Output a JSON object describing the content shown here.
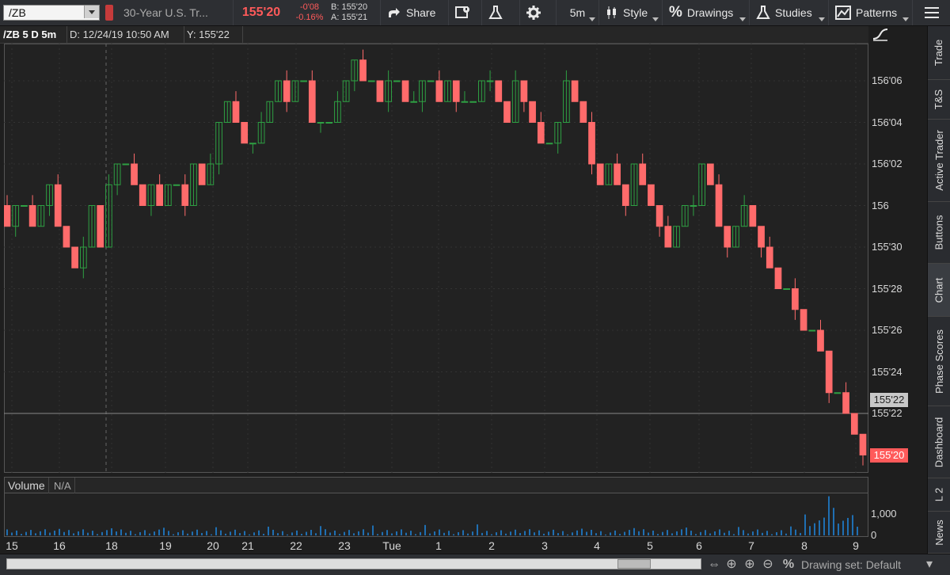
{
  "toolbar": {
    "symbol": "/ZB",
    "description": "30-Year U.S. Tr...",
    "last_price": "155'20",
    "net_change": "-0'08",
    "pct_change": "-0.16%",
    "bid": "B: 155'20",
    "ask": "A: 155'21",
    "share_label": "Share",
    "timeframe_label": "5m",
    "style_label": "Style",
    "drawings_label": "Drawings",
    "studies_label": "Studies",
    "patterns_label": "Patterns"
  },
  "chart_header": {
    "symbol_period": "/ZB 5 D 5m",
    "date_readout": "D: 12/24/19 10:50 AM",
    "y_readout": "Y: 155'22"
  },
  "price_axis": {
    "ticks": [
      "156'06",
      "156'04",
      "156'02",
      "156",
      "155'30",
      "155'28",
      "155'26",
      "155'24",
      "155'22"
    ],
    "cursor_price": "155'22",
    "current_price": "155'20"
  },
  "volume": {
    "title": "Volume",
    "value": "N/A",
    "tick_high": "1,000",
    "tick_low": "0"
  },
  "x_axis": {
    "labels": [
      "15",
      "16",
      "18",
      "19",
      "20",
      "21",
      "22",
      "23",
      "Tue",
      "1",
      "2",
      "3",
      "4",
      "5",
      "6",
      "7",
      "8",
      "9"
    ]
  },
  "sidebar": {
    "tabs": [
      "Trade",
      "T&S",
      "Active Trader",
      "Buttons",
      "Chart",
      "Phase Scores",
      "Dashboard",
      "L 2",
      "News"
    ]
  },
  "bottom_bar": {
    "drawing_set": "Drawing set: Default"
  },
  "colors": {
    "up": "#2ea043",
    "down": "#ff6b6b",
    "accent_price": "#ff5a5a",
    "volume": "#1f6fb2"
  },
  "chart_data": {
    "type": "candlestick",
    "y_unit": "32nds of a point",
    "ylim": [
      155.59375,
      156.21875
    ],
    "price_at_tick": [
      156.1875,
      156.125,
      156.0625,
      156.0,
      155.9375,
      155.875,
      155.8125,
      155.75,
      155.6875
    ],
    "close_series": [
      155.96875,
      156.0,
      156.0,
      155.96875,
      156.0,
      156.03125,
      155.96875,
      155.9375,
      155.90625,
      155.9375,
      156.0,
      155.9375,
      156.03125,
      156.0625,
      156.0625,
      156.03125,
      156.0,
      156.03125,
      156.0,
      156.03125,
      156.03125,
      156.0,
      156.0625,
      156.03125,
      156.0625,
      156.125,
      156.15625,
      156.125,
      156.09375,
      156.09375,
      156.125,
      156.15625,
      156.1875,
      156.15625,
      156.1875,
      156.1875,
      156.125,
      156.125,
      156.125,
      156.15625,
      156.1875,
      156.21875,
      156.1875,
      156.1875,
      156.15625,
      156.1875,
      156.1875,
      156.15625,
      156.15625,
      156.1875,
      156.1875,
      156.15625,
      156.1875,
      156.15625,
      156.15625,
      156.15625,
      156.1875,
      156.1875,
      156.15625,
      156.125,
      156.1875,
      156.15625,
      156.125,
      156.09375,
      156.09375,
      156.125,
      156.1875,
      156.15625,
      156.125,
      156.0625,
      156.03125,
      156.0625,
      156.03125,
      156.0,
      156.0625,
      156.03125,
      156.0,
      155.96875,
      155.9375,
      155.96875,
      156.0,
      156.0,
      156.0625,
      156.03125,
      155.96875,
      155.9375,
      155.96875,
      156.0,
      155.96875,
      155.9375,
      155.90625,
      155.875,
      155.875,
      155.84375,
      155.8125,
      155.8125,
      155.78125,
      155.71875,
      155.71875,
      155.6875,
      155.65625,
      155.625
    ],
    "volume_max_tick": 1000
  }
}
